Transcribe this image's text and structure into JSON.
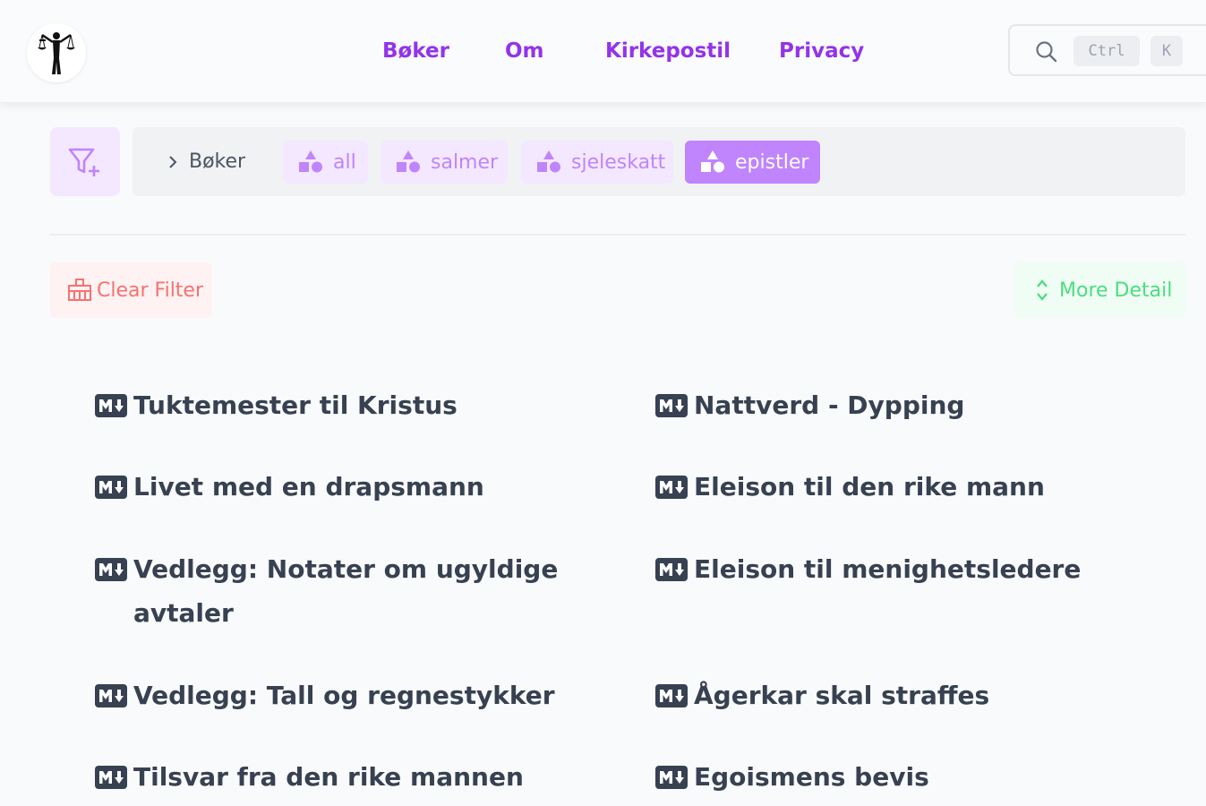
{
  "header": {
    "logo_icon": "scales-of-justice-figure-icon",
    "nav": [
      "Bøker",
      "Om",
      "Kirkepostil",
      "Privacy"
    ],
    "search": {
      "icon": "search-icon",
      "key1": "Ctrl",
      "key2": "K"
    }
  },
  "filter": {
    "filter_icon": "filter-plus-icon",
    "breadcrumb": "Bøker",
    "tags": [
      {
        "label": "all",
        "active": false
      },
      {
        "label": "salmer",
        "active": false
      },
      {
        "label": "sjeleskatt",
        "active": false
      },
      {
        "label": "epistler",
        "active": true
      }
    ]
  },
  "actions": {
    "clear_label": "Clear Filter",
    "more_label": "More Detail"
  },
  "items": [
    "Tuktemester til Kristus",
    "Nattverd - Dypping",
    "Livet med en drapsmann",
    "Eleison til den rike mann",
    "Vedlegg: Notater om ugyldige avtaler",
    "Eleison til menighetsledere",
    "Vedlegg: Tall og regnestykker",
    "Ågerkar skal straffes",
    "Tilsvar fra den rike mannen",
    "Egoismens bevis"
  ],
  "colors": {
    "accent": "#9333ea",
    "tag_bg": "#f3e8ff",
    "tag_active": "#c084fc",
    "clear": "#f87171",
    "more": "#4ade80"
  }
}
